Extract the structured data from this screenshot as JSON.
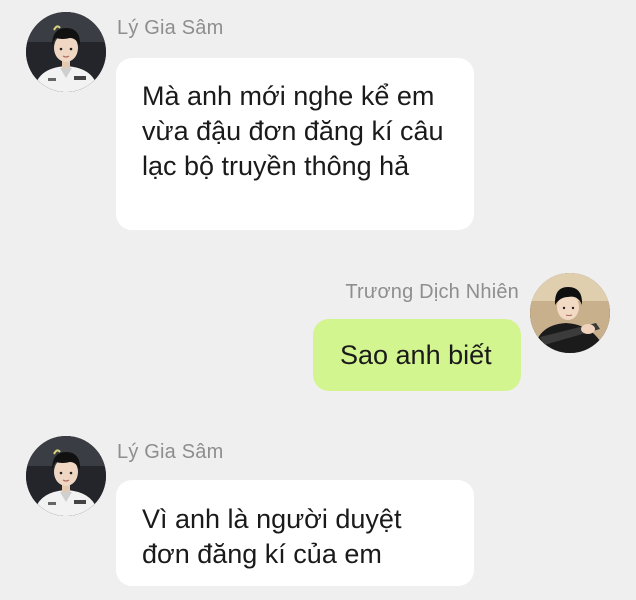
{
  "messages": [
    {
      "sender": "Lý Gia Sâm",
      "text": "Mà anh mới nghe kể em vừa đậu đơn đăng kí câu lạc bộ truyền thông hả",
      "direction": "incoming",
      "avatar_icon": "avatar-ly-gia-sam"
    },
    {
      "sender": "Trương Dịch Nhiên",
      "text": "Sao anh biết",
      "direction": "outgoing",
      "avatar_icon": "avatar-truong-dich-nhien"
    },
    {
      "sender": "Lý Gia Sâm",
      "text": "Vì anh là người duyệt đơn đăng kí của em",
      "direction": "incoming",
      "avatar_icon": "avatar-ly-gia-sam"
    }
  ],
  "colors": {
    "background": "#efefef",
    "incoming_bubble": "#ffffff",
    "outgoing_bubble": "#d3f58f",
    "name_text": "#8e8e8e",
    "message_text": "#1a1a1a"
  }
}
